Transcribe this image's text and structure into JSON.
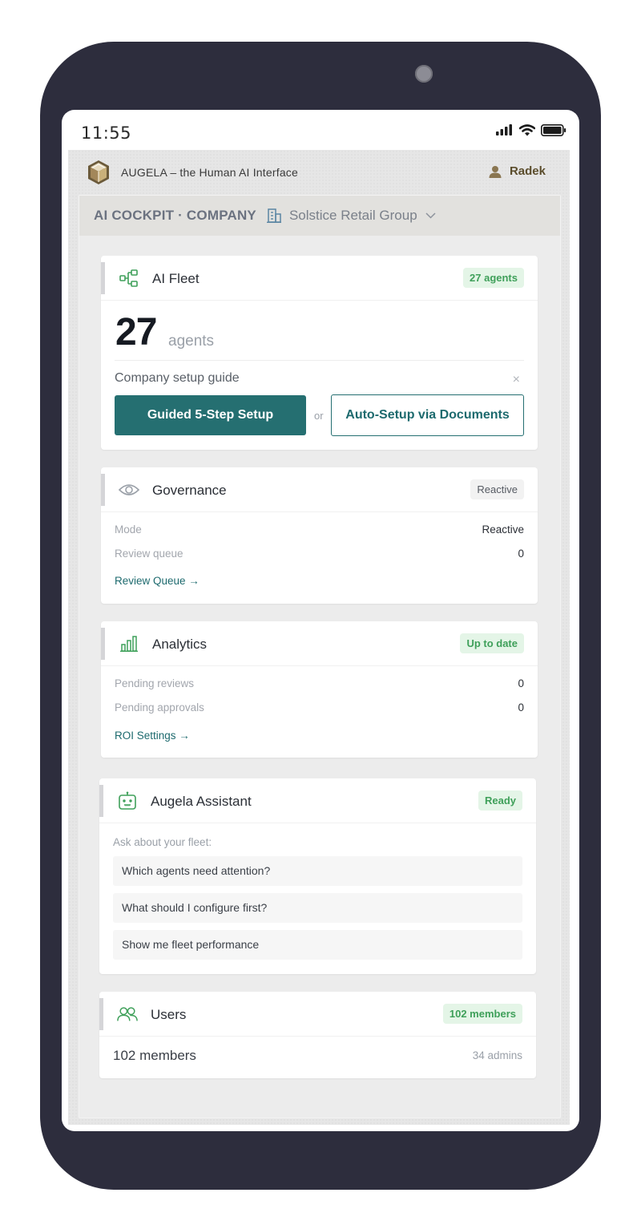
{
  "status_bar": {
    "time": "11:55"
  },
  "topbar": {
    "brand": "AUGELA – the Human AI Interface",
    "user_name": "Radek"
  },
  "context": {
    "title": "AI COCKPIT · COMPANY",
    "organization": "Solstice Retail Group"
  },
  "fleet": {
    "title": "AI Fleet",
    "badge": "27 agents",
    "count": "27",
    "unit": "agents",
    "guide_label": "Company setup guide",
    "close_symbol": "×",
    "guided_button": "Guided 5-Step Setup",
    "or_text": "or",
    "auto_button": "Auto-Setup via Documents"
  },
  "governance": {
    "title": "Governance",
    "badge": "Reactive",
    "rows": [
      {
        "label": "Mode",
        "value": "Reactive"
      },
      {
        "label": "Review queue",
        "value": "0"
      }
    ],
    "link": "Review Queue →"
  },
  "analytics": {
    "title": "Analytics",
    "badge": "Up to date",
    "rows": [
      {
        "label": "Pending reviews",
        "value": "0"
      },
      {
        "label": "Pending approvals",
        "value": "0"
      }
    ],
    "link": "ROI Settings →"
  },
  "assistant": {
    "title": "Augela Assistant",
    "badge": "Ready",
    "prompt_label": "Ask about your fleet:",
    "prompts": [
      "Which agents need attention?",
      "What should I configure first?",
      "Show me fleet performance"
    ]
  },
  "users": {
    "title": "Users",
    "badge": "102 members",
    "members": "102 members",
    "admins": "34 admins"
  },
  "colors": {
    "accent_teal": "#256f71",
    "badge_green_bg": "#e4f5e7",
    "badge_green_text": "#3fa05a",
    "icon_green": "#3fa05a",
    "phone_frame": "#2d2d3d"
  },
  "icons": {
    "fleet": "hierarchy-icon",
    "governance": "eye-icon",
    "analytics": "bar-chart-icon",
    "assistant": "robot-icon",
    "users": "users-icon",
    "org": "building-icon",
    "user": "person-icon"
  }
}
